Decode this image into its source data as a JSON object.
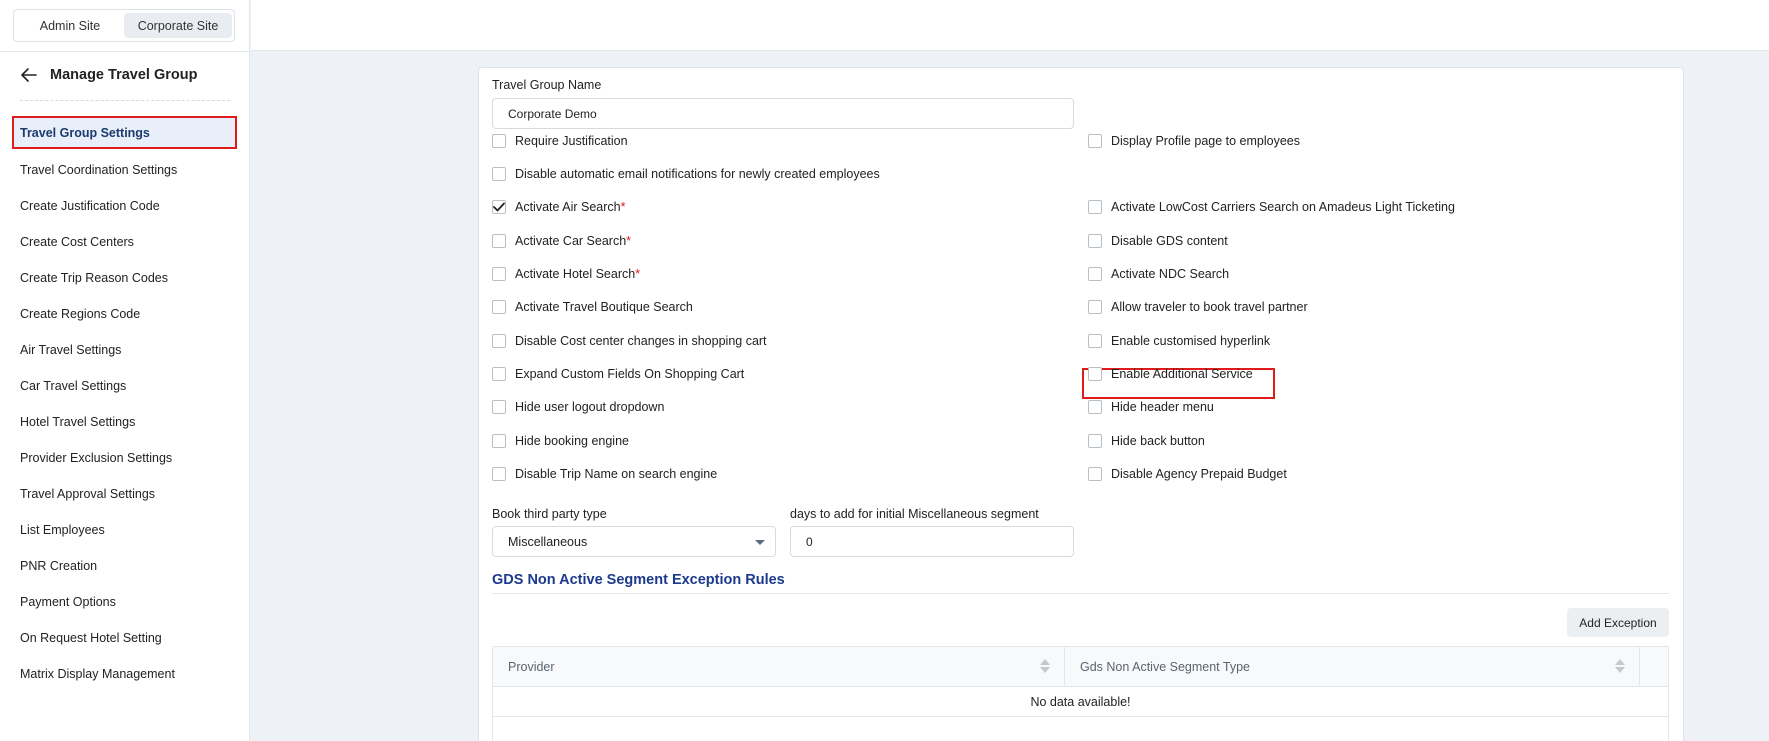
{
  "site_switch": {
    "admin": "Admin Site",
    "corporate": "Corporate Site"
  },
  "sidebar": {
    "title": "Manage Travel Group",
    "items": [
      {
        "label": "Travel Group Settings"
      },
      {
        "label": "Travel Coordination Settings"
      },
      {
        "label": "Create Justification Code"
      },
      {
        "label": "Create Cost Centers"
      },
      {
        "label": "Create Trip Reason Codes"
      },
      {
        "label": "Create Regions Code"
      },
      {
        "label": "Air Travel Settings"
      },
      {
        "label": "Car Travel Settings"
      },
      {
        "label": "Hotel Travel Settings"
      },
      {
        "label": "Provider Exclusion Settings"
      },
      {
        "label": "Travel Approval Settings"
      },
      {
        "label": "List Employees"
      },
      {
        "label": "PNR Creation"
      },
      {
        "label": "Payment Options"
      },
      {
        "label": "On Request Hotel Setting"
      },
      {
        "label": "Matrix Display Management"
      }
    ]
  },
  "form": {
    "group_name_label": "Travel Group Name",
    "group_name_value": "Corporate Demo",
    "left_checks": [
      {
        "label": "Require Justification",
        "checked": false,
        "required": false
      },
      {
        "label": "Disable automatic email notifications for newly created employees",
        "checked": false,
        "required": false
      },
      {
        "label": "Activate Air Search",
        "checked": true,
        "required": true
      },
      {
        "label": "Activate Car Search",
        "checked": false,
        "required": true
      },
      {
        "label": "Activate Hotel Search",
        "checked": false,
        "required": true
      },
      {
        "label": "Activate Travel Boutique Search",
        "checked": false,
        "required": false
      },
      {
        "label": "Disable Cost center changes in shopping cart",
        "checked": false,
        "required": false
      },
      {
        "label": "Expand Custom Fields On Shopping Cart",
        "checked": false,
        "required": false
      },
      {
        "label": "Hide user logout dropdown",
        "checked": false,
        "required": false
      },
      {
        "label": "Hide booking engine",
        "checked": false,
        "required": false
      },
      {
        "label": "Disable Trip Name on search engine",
        "checked": false,
        "required": false
      }
    ],
    "right_checks": [
      {
        "label": "Display Profile page to employees",
        "checked": false
      },
      {
        "label": "Activate LowCost Carriers Search on Amadeus Light Ticketing",
        "checked": false
      },
      {
        "label": "Disable GDS content",
        "checked": false
      },
      {
        "label": "Activate NDC Search",
        "checked": false
      },
      {
        "label": "Allow traveler to book travel partner",
        "checked": false
      },
      {
        "label": "Enable customised hyperlink",
        "checked": false
      },
      {
        "label": "Enable Additional Service",
        "checked": false
      },
      {
        "label": "Hide header menu",
        "checked": false
      },
      {
        "label": "Hide back button",
        "checked": false
      },
      {
        "label": "Disable Agency Prepaid Budget",
        "checked": false
      }
    ],
    "required_mark": "*",
    "third_party_label": "Book third party type",
    "third_party_value": "Miscellaneous",
    "days_label": "days to add for initial Miscellaneous segment",
    "days_value": "0"
  },
  "gds": {
    "title": "GDS Non Active Segment Exception Rules",
    "add_button": "Add Exception",
    "columns": [
      "Provider",
      "Gds Non Active Segment Type"
    ],
    "empty_text": "No data available!"
  },
  "colors": {
    "highlight": "#e01b1b",
    "accent": "#1c3a8c"
  }
}
